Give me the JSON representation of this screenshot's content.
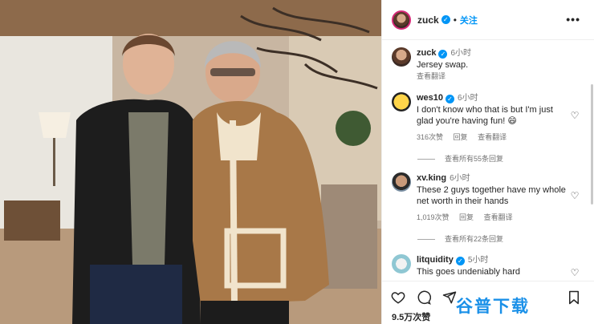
{
  "post": {
    "username": "zuck",
    "follow_label": "关注",
    "separator": "•",
    "more_label": "•••",
    "likes": "9.5万次赞"
  },
  "caption": {
    "username": "zuck",
    "time": "6小时",
    "text": "Jersey swap.",
    "translate": "查看翻译"
  },
  "comments": [
    {
      "username": "wes10",
      "time": "6小时",
      "text": "I don't know who that is but I'm just glad you're having fun! 😄",
      "likes": "316次赞",
      "reply": "回复",
      "translate": "查看翻译",
      "view_replies": "查看所有55条回复"
    },
    {
      "username": "xv.king",
      "time": "6小时",
      "text": "These 2 guys together have my whole net worth in their hands",
      "likes": "1,019次赞",
      "reply": "回复",
      "translate": "查看翻译",
      "view_replies": "查看所有22条回复"
    },
    {
      "username": "litquidity",
      "time": "5小时",
      "text": "This goes undeniably hard"
    }
  ],
  "icons": {
    "verified": "verified-badge-icon",
    "heart": "heart-icon",
    "comment": "comment-icon",
    "share": "share-icon",
    "save": "bookmark-icon"
  },
  "colors": {
    "accent": "#0095f6",
    "muted": "#737373",
    "watermark": "#1a90e8"
  },
  "watermark": {
    "text": "谷普下载"
  }
}
